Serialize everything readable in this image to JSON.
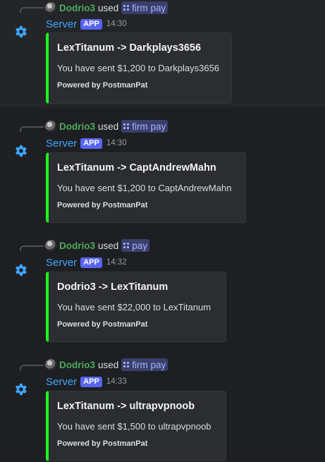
{
  "accent_colors": {
    "username": "#4ea95d",
    "author": "#3ea6ff",
    "app_badge": "#5865f2",
    "embed_bar": "#1dfd1d",
    "command_chip": "#a5b3ff"
  },
  "messages": [
    {
      "reply": {
        "username": "Dodrio3",
        "verb": "used",
        "command": "firm pay"
      },
      "author": "Server",
      "badge": "APP",
      "time": "14:30",
      "embed": {
        "title": "LexTitanum -> Darkplays3656",
        "description": "You have sent $1,200 to Darkplays3656",
        "footer": "Powered by PostmanPat"
      }
    },
    {
      "reply": {
        "username": "Dodrio3",
        "verb": "used",
        "command": "firm pay"
      },
      "author": "Server",
      "badge": "APP",
      "time": "14:30",
      "embed": {
        "title": "LexTitanum -> CaptAndrewMahn",
        "description": "You have sent $1,200 to CaptAndrewMahn",
        "footer": "Powered by PostmanPat"
      }
    },
    {
      "reply": {
        "username": "Dodrio3",
        "verb": "used",
        "command": "pay"
      },
      "author": "Server",
      "badge": "APP",
      "time": "14:32",
      "embed": {
        "title": "Dodrio3 -> LexTitanum",
        "description": "You have sent $22,000 to LexTitanum",
        "footer": "Powered by PostmanPat"
      }
    },
    {
      "reply": {
        "username": "Dodrio3",
        "verb": "used",
        "command": "firm pay"
      },
      "author": "Server",
      "badge": "APP",
      "time": "14:33",
      "embed": {
        "title": "LexTitanum -> ultrapvpnoob",
        "description": "You have sent $1,500 to ultrapvpnoob",
        "footer": "Powered by PostmanPat"
      }
    }
  ]
}
